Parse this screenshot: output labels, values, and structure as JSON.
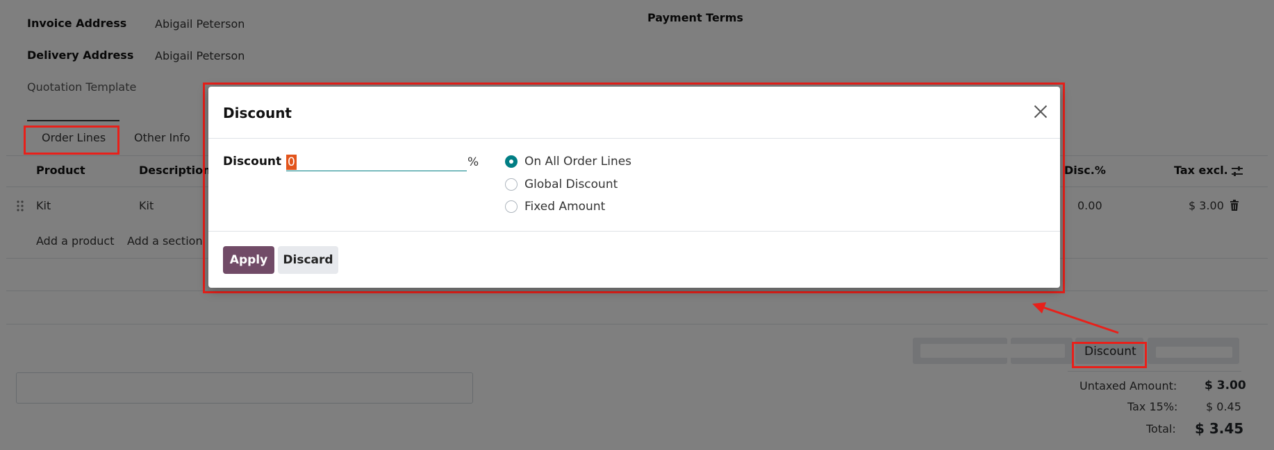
{
  "form": {
    "invoice_address_label": "Invoice Address",
    "invoice_address_value": "Abigail Peterson",
    "delivery_address_label": "Delivery Address",
    "delivery_address_value": "Abigail Peterson",
    "quotation_template_label": "Quotation Template",
    "payment_terms_label": "Payment Terms"
  },
  "tabs": [
    "Order Lines",
    "Other Info"
  ],
  "table": {
    "headers": {
      "product": "Product",
      "description": "Description",
      "disc": "Disc.%",
      "tax_excl": "Tax excl."
    },
    "rows": [
      {
        "product": "Kit",
        "description": "Kit",
        "disc": "0.00",
        "tax_excl": "$ 3.00"
      }
    ],
    "add_product": "Add a product",
    "add_section": "Add a section"
  },
  "footer": {
    "discount_button": "Discount"
  },
  "totals": {
    "untaxed_label": "Untaxed Amount:",
    "untaxed_value": "$ 3.00",
    "tax_label": "Tax 15%:",
    "tax_value": "$ 0.45",
    "total_label": "Total:",
    "total_value": "$ 3.45"
  },
  "dialog": {
    "title": "Discount",
    "discount_label": "Discount",
    "discount_value": "0",
    "percent_sign": "%",
    "options": [
      "On All Order Lines",
      "Global Discount",
      "Fixed Amount"
    ],
    "selected_option": "On All Order Lines",
    "apply_label": "Apply",
    "discard_label": "Discard"
  },
  "colors": {
    "accent": "#017e84",
    "primary_button": "#714b67",
    "highlight": "#e8201a",
    "selection": "#e2541b"
  }
}
